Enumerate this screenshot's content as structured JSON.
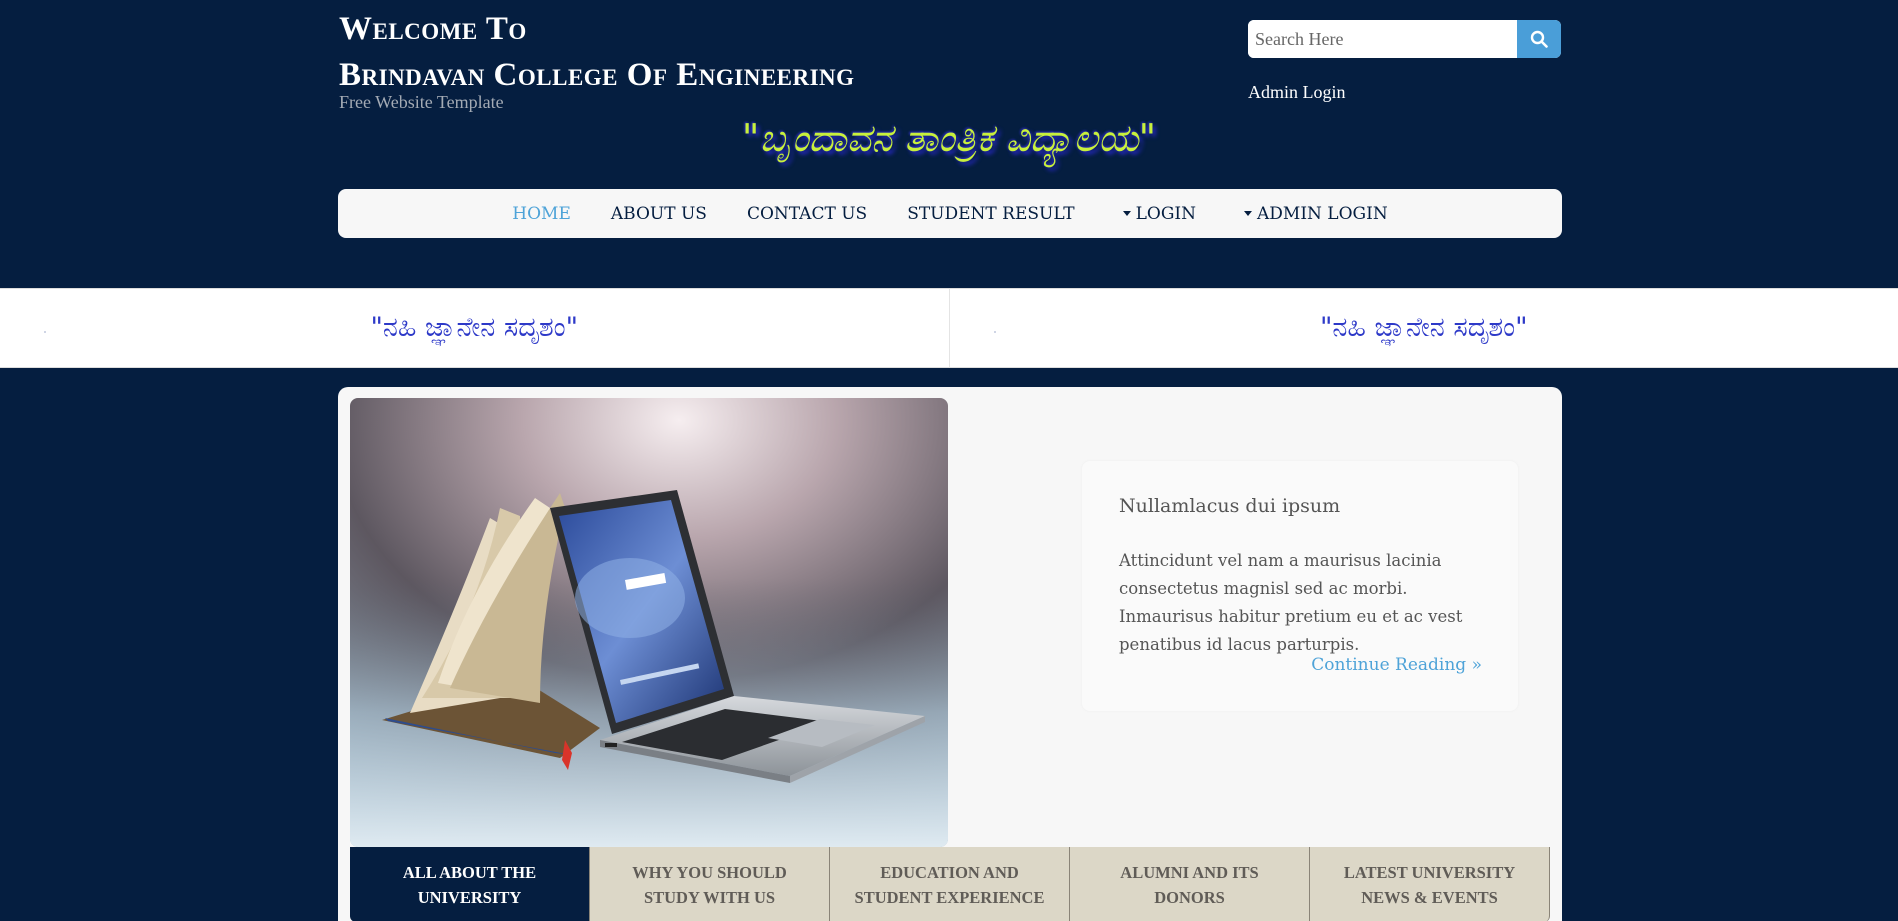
{
  "header": {
    "title_line1": "Welcome To",
    "title_line2": "Brindavan College Of Engineering",
    "tagline": "Free Website Template",
    "kannada_title": "\"ಬೃಂದಾವನ ತಾಂತ್ರಿಕ ವಿದ್ಯಾಲಯ\"",
    "admin_link": "Admin Login"
  },
  "search": {
    "placeholder": "Search Here",
    "button_icon": "search-icon"
  },
  "nav": {
    "items": [
      {
        "label": "HOME",
        "active": true
      },
      {
        "label": "ABOUT US"
      },
      {
        "label": "CONTACT US"
      },
      {
        "label": "STUDENT RESULT"
      },
      {
        "label": "LOGIN",
        "dropdown": true
      },
      {
        "label": "ADMIN LOGIN",
        "dropdown": true
      }
    ]
  },
  "strip": {
    "items": [
      "\"ನಹಿ ಜ್ಞಾನೇನ ಸದೃಶಂ\"",
      "\"ನಹಿ ಜ್ಞಾನೇನ ಸದೃಶಂ\""
    ]
  },
  "feature": {
    "title": "Nullamlacus dui ipsum",
    "text": "Attincidunt vel nam a maurisus lacinia consectetus magnisl sed ac morbi. Inmaurisus habitur pretium eu et ac vest penatibus id lacus parturpis.",
    "link": "Continue Reading »"
  },
  "tabs": [
    {
      "label": "ALL ABOUT THE UNIVERSITY",
      "active": true
    },
    {
      "label": "WHY YOU SHOULD STUDY WITH US"
    },
    {
      "label": "EDUCATION AND STUDENT EXPERIENCE"
    },
    {
      "label": "ALUMNI AND ITS DONORS"
    },
    {
      "label": "LATEST UNIVERSITY NEWS & EVENTS"
    }
  ],
  "colors": {
    "background": "#051e40",
    "accent": "#4ea3d8",
    "kannada_green": "#c8f03c",
    "kannada_blue": "#2d39c8",
    "tab_bg": "#dcd7c7"
  }
}
